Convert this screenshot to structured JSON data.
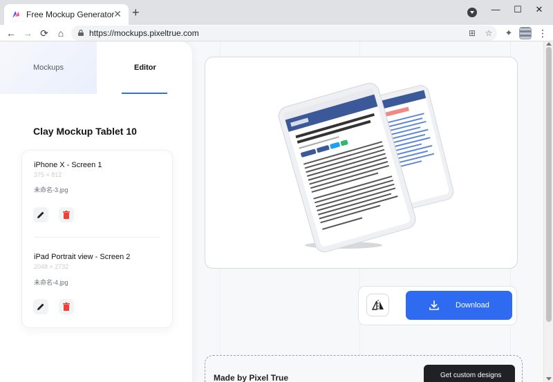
{
  "browser": {
    "tab_title": "Free Mockup Generator",
    "tab_close": "✕",
    "new_tab": "+",
    "url": "https://mockups.pixeltrue.com",
    "window": {
      "minimize": "—",
      "maximize": "☐",
      "close": "✕"
    },
    "nav": {
      "back": "←",
      "forward": "→",
      "reload": "⟳",
      "home": "⌂"
    },
    "menu": "⋮"
  },
  "sidebar": {
    "tabs": [
      {
        "label": "Mockups"
      },
      {
        "label": "Editor"
      }
    ],
    "active_tab": "Editor",
    "panel_title": "Clay Mockup Tablet 10",
    "screens": [
      {
        "name": "iPhone X - Screen 1",
        "dimensions": "375 × 812",
        "file": "未命名-3.jpg"
      },
      {
        "name": "iPad Portrait view - Screen 2",
        "dimensions": "2048 × 2732",
        "file": "未命名-4.jpg"
      }
    ]
  },
  "actions": {
    "download_label": "Download"
  },
  "footer": {
    "made_by": "Made by Pixel True",
    "custom_designs_label": "Get custom designs"
  },
  "colors": {
    "accent": "#2f6bf0",
    "delete": "#ea4335",
    "dark_button": "#202124"
  }
}
